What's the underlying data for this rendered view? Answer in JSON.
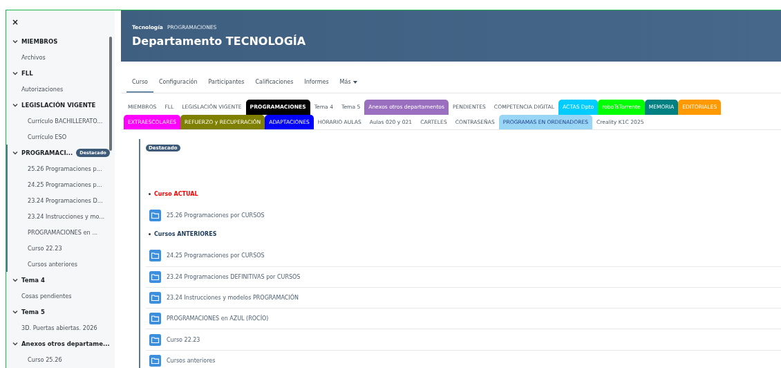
{
  "sidebar": {
    "close": "×",
    "sections": [
      {
        "title": "MIEMBROS",
        "expanded": true,
        "current": false,
        "items": [
          {
            "label": "Archivos",
            "kind": "activity"
          }
        ]
      },
      {
        "title": "FLL",
        "expanded": true,
        "current": false,
        "items": [
          {
            "label": "Autorizaciones",
            "kind": "activity"
          }
        ]
      },
      {
        "title": "LEGISLACIÓN VIGENTE",
        "expanded": true,
        "current": false,
        "items": [
          {
            "label": "Currículo BACHILLERATO...",
            "kind": "nested"
          },
          {
            "label": "Currículo ESO",
            "kind": "nested"
          }
        ]
      },
      {
        "title": "PROGRAMACI...",
        "badge": "Destacado",
        "expanded": true,
        "current": true,
        "items": [
          {
            "label": "25.26 Programaciones p...",
            "kind": "nested"
          },
          {
            "label": "24.25 Programaciones p...",
            "kind": "nested"
          },
          {
            "label": "23.24 Programaciones D...",
            "kind": "nested"
          },
          {
            "label": "23.24 Instrucciones y mo...",
            "kind": "nested"
          },
          {
            "label": "PROGRAMACIONES en ...",
            "kind": "nested"
          },
          {
            "label": "Curso 22.23",
            "kind": "nested"
          },
          {
            "label": "Cursos anteriores",
            "kind": "nested"
          }
        ]
      },
      {
        "title": "Tema 4",
        "expanded": true,
        "current": false,
        "items": [
          {
            "label": "Cosas pendientes",
            "kind": "activity"
          }
        ]
      },
      {
        "title": "Tema 5",
        "expanded": true,
        "current": false,
        "items": [
          {
            "label": "3D. Puertas abiertas. 2026",
            "kind": "activity"
          }
        ]
      },
      {
        "title": "Anexos otros departame...",
        "expanded": true,
        "current": false,
        "items": [
          {
            "label": "Curso 25.26",
            "kind": "nested"
          }
        ]
      }
    ]
  },
  "header": {
    "breadcrumb": [
      "Tecnología",
      "PROGRAMACIONES"
    ],
    "title": "Departamento TECNOLOGÍA"
  },
  "nav_tabs": [
    {
      "label": "Curso",
      "selected": true
    },
    {
      "label": "Configuración",
      "selected": false
    },
    {
      "label": "Participantes",
      "selected": false
    },
    {
      "label": "Calificaciones",
      "selected": false
    },
    {
      "label": "Informes",
      "selected": false
    },
    {
      "label": "Más",
      "selected": false,
      "dropdown": true
    }
  ],
  "section_tabs": [
    [
      {
        "label": "MIEMBROS",
        "selected": false
      },
      {
        "label": "FLL",
        "selected": false
      },
      {
        "label": "LEGISLACIÓN VIGENTE",
        "selected": false
      },
      {
        "label": "PROGRAMACIONES",
        "selected": true,
        "color": "#000000"
      },
      {
        "label": "Tema 4",
        "selected": false
      },
      {
        "label": "Tema 5",
        "selected": false
      },
      {
        "label": "Anexos otros departamentos",
        "selected": false,
        "color": "#9a6fc0"
      },
      {
        "label": "PENDIENTES",
        "selected": false
      },
      {
        "label": "COMPETENCIA DIGITAL",
        "selected": false
      },
      {
        "label": "ACTAS Dpto",
        "selected": false,
        "color": "#00ccff"
      },
      {
        "label": "roboTsTorrente",
        "selected": false,
        "color": "#00ff00"
      },
      {
        "label": "MEMORIA",
        "selected": false,
        "color": "#008080"
      },
      {
        "label": "EDITORIALES",
        "selected": false,
        "color": "#ff9900"
      }
    ],
    [
      {
        "label": "EXTRAESCOLARES",
        "selected": false,
        "color": "#ff00ff"
      },
      {
        "label": "REFUERZO y RECUPERACIÓN",
        "selected": false,
        "color": "#808000"
      },
      {
        "label": "ADAPTACIONES",
        "selected": false,
        "color": "#0000ff"
      },
      {
        "label": "HORARIO AULAS",
        "selected": false
      },
      {
        "label": "Aulas 020 y 021",
        "selected": false
      },
      {
        "label": "CARTELES",
        "selected": false
      },
      {
        "label": "CONTRASEÑAS",
        "selected": false
      },
      {
        "label": "PROGRAMAS EN ORDENADORES",
        "selected": false,
        "color": "#99d6f5"
      },
      {
        "label": "Creality K1C 2025",
        "selected": false
      }
    ]
  ],
  "content": {
    "badge": "Destacado",
    "groups": [
      {
        "heading": "Curso ACTUAL",
        "color": "#ff0000",
        "folders": [
          "25.26 Programaciones por CURSOS"
        ]
      },
      {
        "heading": "Cursos ANTERIORES",
        "color": "#1d3b5c",
        "folders": [
          "24.25 Programaciones por CURSOS",
          "23.24 Programaciones DEFINITIVAS por CURSOS",
          "23.24 Instrucciones y modelos PROGRAMACIÓN",
          "PROGRAMACIONES en AZUL (ROCÍO)",
          "Curso 22.23",
          "Cursos anteriores"
        ]
      }
    ]
  }
}
